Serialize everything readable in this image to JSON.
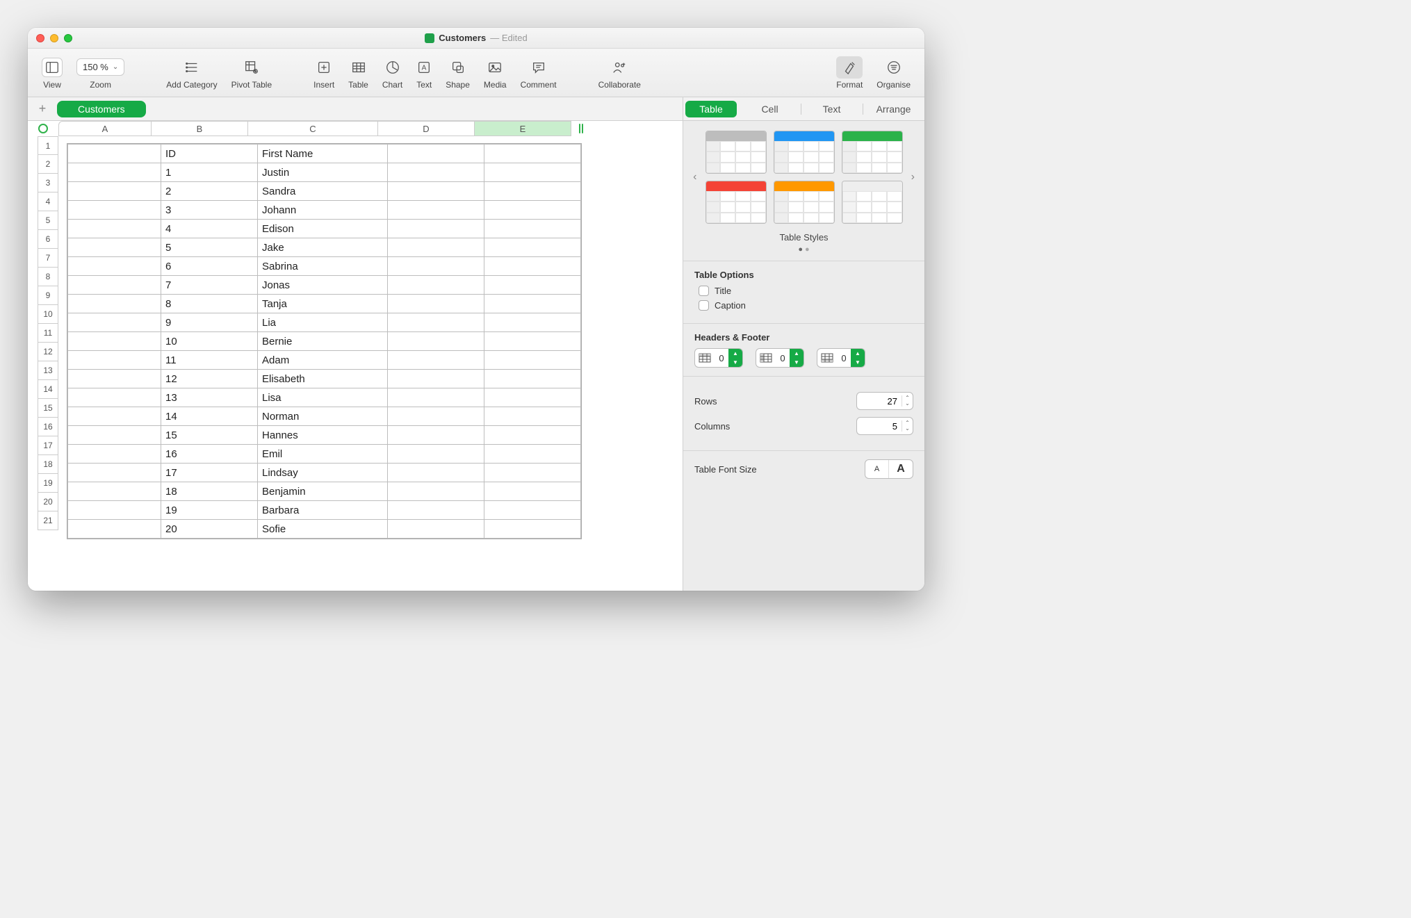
{
  "title": {
    "name": "Customers",
    "status": "Edited"
  },
  "toolbar": {
    "view": "View",
    "zoom_value": "150 %",
    "zoom": "Zoom",
    "add_category": "Add Category",
    "pivot_table": "Pivot Table",
    "insert": "Insert",
    "table": "Table",
    "chart": "Chart",
    "text": "Text",
    "shape": "Shape",
    "media": "Media",
    "comment": "Comment",
    "collaborate": "Collaborate",
    "format": "Format",
    "organise": "Organise"
  },
  "sheet": {
    "name": "Customers"
  },
  "columns": [
    "A",
    "B",
    "C",
    "D",
    "E"
  ],
  "row_numbers": [
    "1",
    "2",
    "3",
    "4",
    "5",
    "6",
    "7",
    "8",
    "9",
    "10",
    "11",
    "12",
    "13",
    "14",
    "15",
    "16",
    "17",
    "18",
    "19",
    "20",
    "21"
  ],
  "table_rows": [
    {
      "a": "",
      "b": "ID",
      "c": "First Name",
      "d": "",
      "e": ""
    },
    {
      "a": "",
      "b": "1",
      "c": "Justin",
      "d": "",
      "e": ""
    },
    {
      "a": "",
      "b": "2",
      "c": "Sandra",
      "d": "",
      "e": ""
    },
    {
      "a": "",
      "b": "3",
      "c": "Johann",
      "d": "",
      "e": ""
    },
    {
      "a": "",
      "b": "4",
      "c": "Edison",
      "d": "",
      "e": ""
    },
    {
      "a": "",
      "b": "5",
      "c": "Jake",
      "d": "",
      "e": ""
    },
    {
      "a": "",
      "b": "6",
      "c": "Sabrina",
      "d": "",
      "e": ""
    },
    {
      "a": "",
      "b": "7",
      "c": "Jonas",
      "d": "",
      "e": ""
    },
    {
      "a": "",
      "b": "8",
      "c": "Tanja",
      "d": "",
      "e": ""
    },
    {
      "a": "",
      "b": "9",
      "c": "Lia",
      "d": "",
      "e": ""
    },
    {
      "a": "",
      "b": "10",
      "c": "Bernie",
      "d": "",
      "e": ""
    },
    {
      "a": "",
      "b": "11",
      "c": "Adam",
      "d": "",
      "e": ""
    },
    {
      "a": "",
      "b": "12",
      "c": "Elisabeth",
      "d": "",
      "e": ""
    },
    {
      "a": "",
      "b": "13",
      "c": "Lisa",
      "d": "",
      "e": ""
    },
    {
      "a": "",
      "b": "14",
      "c": "Norman",
      "d": "",
      "e": ""
    },
    {
      "a": "",
      "b": "15",
      "c": "Hannes",
      "d": "",
      "e": ""
    },
    {
      "a": "",
      "b": "16",
      "c": "Emil",
      "d": "",
      "e": ""
    },
    {
      "a": "",
      "b": "17",
      "c": "Lindsay",
      "d": "",
      "e": ""
    },
    {
      "a": "",
      "b": "18",
      "c": "Benjamin",
      "d": "",
      "e": ""
    },
    {
      "a": "",
      "b": "19",
      "c": "Barbara",
      "d": "",
      "e": ""
    },
    {
      "a": "",
      "b": "20",
      "c": "Sofie",
      "d": "",
      "e": ""
    }
  ],
  "inspector": {
    "tabs": {
      "table": "Table",
      "cell": "Cell",
      "text": "Text",
      "arrange": "Arrange"
    },
    "styles_label": "Table Styles",
    "options_heading": "Table Options",
    "opt_title": "Title",
    "opt_caption": "Caption",
    "headers_heading": "Headers & Footer",
    "hf1": "0",
    "hf2": "0",
    "hf3": "0",
    "rows_label": "Rows",
    "rows_val": "27",
    "cols_label": "Columns",
    "cols_val": "5",
    "fontsize_label": "Table Font Size",
    "small_a": "A",
    "big_a": "A"
  },
  "style_colors": [
    "#bdbdbd",
    "#2196f3",
    "#2bb24a",
    "#f44336",
    "#ff9800",
    "#ffffff"
  ]
}
